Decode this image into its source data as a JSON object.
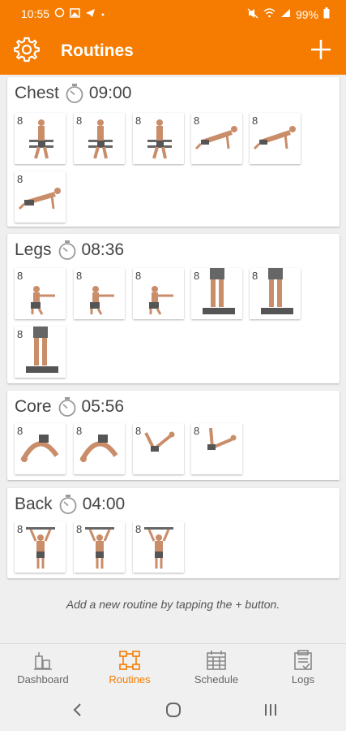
{
  "status": {
    "time": "10:55",
    "battery": "99%"
  },
  "appbar": {
    "title": "Routines"
  },
  "routines": [
    {
      "name": "Chest",
      "time": "09:00",
      "exercises": [
        8,
        8,
        8,
        8,
        8,
        8
      ]
    },
    {
      "name": "Legs",
      "time": "08:36",
      "exercises": [
        8,
        8,
        8,
        8,
        8,
        8
      ]
    },
    {
      "name": "Core",
      "time": "05:56",
      "exercises": [
        8,
        8,
        8,
        8
      ]
    },
    {
      "name": "Back",
      "time": "04:00",
      "exercises": [
        8,
        8,
        8
      ]
    }
  ],
  "hint": "Add a new routine by tapping the + button.",
  "nav": {
    "dashboard": "Dashboard",
    "routines": "Routines",
    "schedule": "Schedule",
    "logs": "Logs",
    "active_color": "#f57c00"
  },
  "colors": {
    "brand": "#f57c00"
  }
}
